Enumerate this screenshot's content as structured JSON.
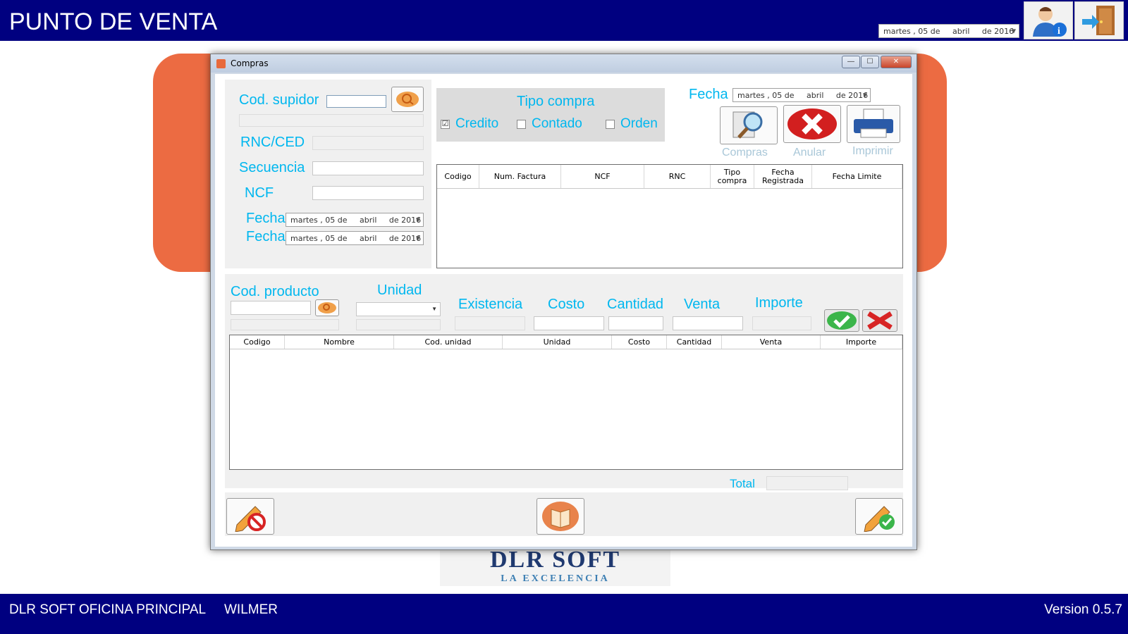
{
  "app": {
    "title": "PUNTO DE VENTA",
    "date": {
      "weekday": "martes",
      "day": ", 05 de",
      "month": "abril",
      "year": "de 2016"
    }
  },
  "status": {
    "branch": "DLR SOFT OFICINA PRINCIPAL",
    "user": "WILMER",
    "version": "Version 0.5.7"
  },
  "logo": {
    "line1": "DLR SOFT",
    "line2": "LA EXCELENCIA"
  },
  "window": {
    "title": "Compras",
    "buttons": {
      "minimize": "—",
      "maximize": "☐",
      "close": "✕"
    }
  },
  "supplier": {
    "cod_label": "Cod. supidor",
    "cod_value": "",
    "rnc_label": "RNC/CED",
    "secuencia_label": "Secuencia",
    "ncf_label": "NCF",
    "fecha1_label": "Fecha",
    "fecha2_label": "Fecha",
    "date1": {
      "weekday": "martes",
      "day": ", 05 de",
      "month": "abril",
      "year": "de 2016"
    },
    "date2": {
      "weekday": "martes",
      "day": ", 05 de",
      "month": "abril",
      "year": "de 2016"
    }
  },
  "tipo": {
    "title": "Tipo compra",
    "credito": "Credito",
    "contado": "Contado",
    "orden": "Orden",
    "credito_checked": "☑",
    "contado_checked": "",
    "orden_checked": ""
  },
  "header_date": {
    "label": "Fecha",
    "weekday": "martes",
    "day": ", 05 de",
    "month": "abril",
    "year": "de 2016"
  },
  "actions": {
    "compras": "Compras",
    "anular": "Anular",
    "imprimir": "Imprimir"
  },
  "purchases_grid": {
    "columns": [
      "Codigo",
      "Num. Factura",
      "NCF",
      "RNC",
      "Tipo compra",
      "Fecha Registrada",
      "Fecha Limite"
    ],
    "rows": []
  },
  "product": {
    "cod_label": "Cod. producto",
    "unidad_label": "Unidad",
    "existencia_label": "Existencia",
    "costo_label": "Costo",
    "cantidad_label": "Cantidad",
    "venta_label": "Venta",
    "importe_label": "Importe"
  },
  "items_grid": {
    "columns": [
      "Codigo",
      "Nombre",
      "Cod. unidad",
      "Unidad",
      "Costo",
      "Cantidad",
      "Venta",
      "Importe"
    ],
    "rows": []
  },
  "total": {
    "label": "Total",
    "value": ""
  },
  "colors": {
    "titlebar": "#000080",
    "label": "#00b7ef",
    "accent": "#ec6b42"
  }
}
